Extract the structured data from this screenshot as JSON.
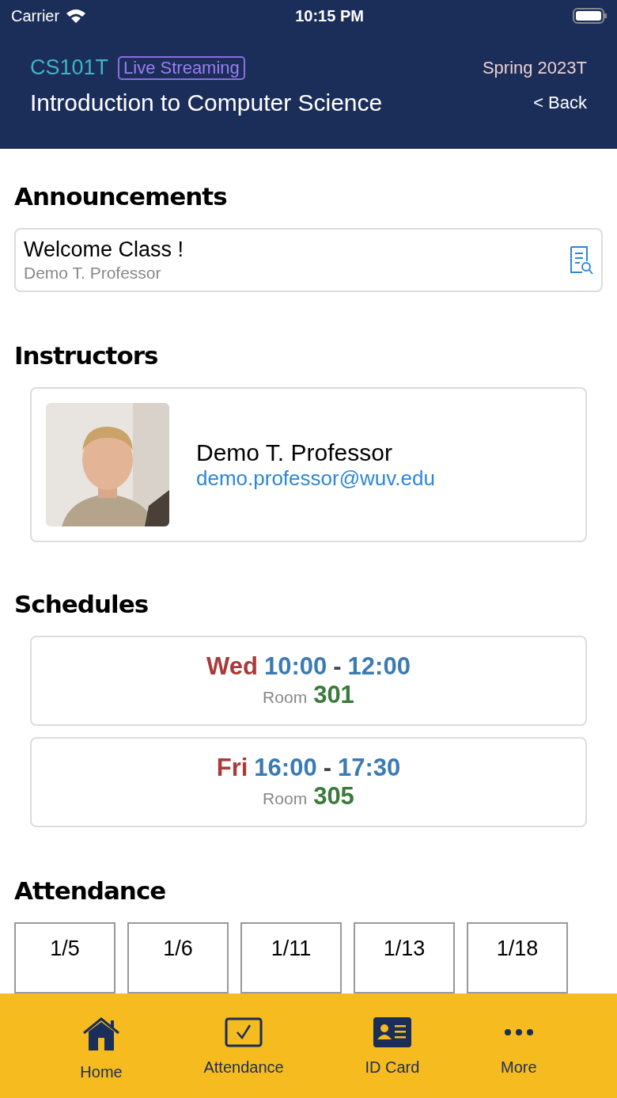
{
  "status_bar": {
    "carrier": "Carrier",
    "time": "10:15 PM"
  },
  "header": {
    "course_code": "CS101T",
    "badge": "Live Streaming",
    "term": "Spring 2023T",
    "title": "Introduction to Computer Science",
    "back": "< Back"
  },
  "announcements": {
    "heading": "Announcements",
    "items": [
      {
        "title": "Welcome Class !",
        "author": "Demo T. Professor"
      }
    ]
  },
  "instructors": {
    "heading": "Instructors",
    "items": [
      {
        "name": "Demo T. Professor",
        "email": "demo.professor@wuv.edu"
      }
    ]
  },
  "schedules": {
    "heading": "Schedules",
    "items": [
      {
        "day": "Wed",
        "start": "10:00",
        "dash": "-",
        "end": "12:00",
        "room_label": "Room",
        "room": "301"
      },
      {
        "day": "Fri",
        "start": "16:00",
        "dash": "-",
        "end": "17:30",
        "room_label": "Room",
        "room": "305"
      }
    ]
  },
  "attendance": {
    "heading": "Attendance",
    "items": [
      {
        "date": "1/5"
      },
      {
        "date": "1/6"
      },
      {
        "date": "1/11"
      },
      {
        "date": "1/13"
      },
      {
        "date": "1/18"
      }
    ]
  },
  "tab_bar": [
    {
      "kind": "home",
      "label": "Home"
    },
    {
      "kind": "attendance",
      "label": "Attendance"
    },
    {
      "kind": "idcard",
      "label": "ID Card"
    },
    {
      "kind": "more",
      "label": "More"
    }
  ]
}
